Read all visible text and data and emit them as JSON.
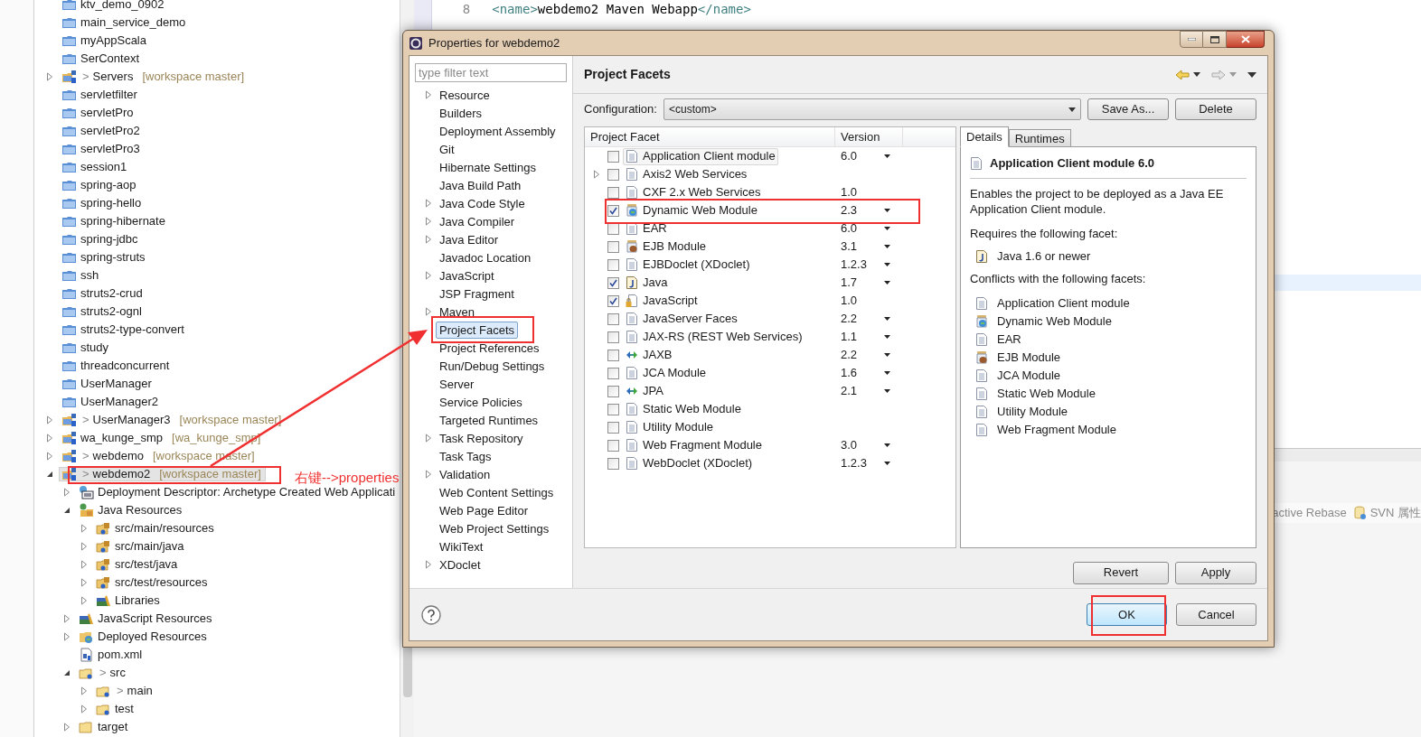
{
  "project_tree": [
    {
      "label": "ktv_demo_0902",
      "kind": "project",
      "selected": false
    },
    {
      "label": "main_service_demo",
      "kind": "project",
      "selected": false
    },
    {
      "label": "myAppScala",
      "kind": "project",
      "selected": false
    },
    {
      "label": "SerContext",
      "kind": "project",
      "selected": false
    },
    {
      "label": "Servers",
      "prefix": ">",
      "repo": "[workspace master]",
      "kind": "git-project",
      "expanded": false,
      "selected": false
    },
    {
      "label": "servletfilter",
      "kind": "project",
      "selected": false
    },
    {
      "label": "servletPro",
      "kind": "project",
      "selected": false
    },
    {
      "label": "servletPro2",
      "kind": "project",
      "selected": false
    },
    {
      "label": "servletPro3",
      "kind": "project",
      "selected": false
    },
    {
      "label": "session1",
      "kind": "project",
      "selected": false
    },
    {
      "label": "spring-aop",
      "kind": "project",
      "selected": false
    },
    {
      "label": "spring-hello",
      "kind": "project",
      "selected": false
    },
    {
      "label": "spring-hibernate",
      "kind": "project",
      "selected": false
    },
    {
      "label": "spring-jdbc",
      "kind": "project",
      "selected": false
    },
    {
      "label": "spring-struts",
      "kind": "project",
      "selected": false
    },
    {
      "label": "ssh",
      "kind": "project",
      "selected": false
    },
    {
      "label": "struts2-crud",
      "kind": "project",
      "selected": false
    },
    {
      "label": "struts2-ognl",
      "kind": "project",
      "selected": false
    },
    {
      "label": "struts2-type-convert",
      "kind": "project",
      "selected": false
    },
    {
      "label": "study",
      "kind": "project",
      "selected": false
    },
    {
      "label": "threadconcurrent",
      "kind": "project",
      "selected": false
    },
    {
      "label": "UserManager",
      "kind": "project",
      "selected": false
    },
    {
      "label": "UserManager2",
      "kind": "project",
      "selected": false
    },
    {
      "label": "UserManager3",
      "prefix": ">",
      "repo": "[workspace master]",
      "kind": "web-project",
      "expanded": false,
      "selected": false
    },
    {
      "label": "wa_kunge_smp",
      "repo": "[wa_kunge_smp]",
      "kind": "web-project",
      "expanded": false,
      "selected": false
    },
    {
      "label": "webdemo",
      "prefix": ">",
      "repo": "[workspace master]",
      "kind": "maven-project",
      "expanded": false,
      "selected": false
    },
    {
      "label": "webdemo2",
      "prefix": ">",
      "repo": "[workspace master]",
      "kind": "maven-project",
      "expanded": true,
      "selected": true,
      "children": [
        {
          "label": "Deployment Descriptor: Archetype Created Web Applicati",
          "kind": "descriptor",
          "expanded": false,
          "selected": false
        },
        {
          "label": "Java Resources",
          "kind": "java-resources",
          "expanded": true,
          "selected": false,
          "children": [
            {
              "label": "src/main/resources",
              "kind": "src-folder",
              "expanded": false,
              "selected": false
            },
            {
              "label": "src/main/java",
              "kind": "src-folder",
              "expanded": false,
              "selected": false
            },
            {
              "label": "src/test/java",
              "kind": "src-folder",
              "expanded": false,
              "selected": false
            },
            {
              "label": "src/test/resources",
              "kind": "src-folder",
              "expanded": false,
              "selected": false
            },
            {
              "label": "Libraries",
              "kind": "library",
              "expanded": false,
              "selected": false
            }
          ]
        },
        {
          "label": "JavaScript Resources",
          "kind": "library",
          "expanded": false,
          "selected": false
        },
        {
          "label": "Deployed Resources",
          "kind": "deployed",
          "expanded": false,
          "selected": false
        },
        {
          "label": "pom.xml",
          "kind": "xml-file",
          "selected": false
        },
        {
          "label": "src",
          "prefix": ">",
          "kind": "git-folder",
          "expanded": true,
          "selected": false,
          "children": [
            {
              "label": "main",
              "prefix": ">",
              "kind": "git-folder",
              "expanded": false,
              "selected": false
            },
            {
              "label": "test",
              "kind": "git-folder",
              "expanded": false,
              "selected": false
            }
          ]
        },
        {
          "label": "target",
          "kind": "folder",
          "expanded": false,
          "selected": false
        }
      ]
    }
  ],
  "editor": {
    "lines": [
      {
        "number": "8",
        "segments": [
          {
            "kind": "tag",
            "text": "<name>"
          },
          {
            "kind": "text",
            "text": "webdemo2 Maven Webapp"
          },
          {
            "kind": "tag",
            "text": "</name>"
          }
        ]
      }
    ]
  },
  "bottom_toolbar": {
    "items": [
      "active Rebase",
      "SVN 属性"
    ]
  },
  "annotation": {
    "text": "右键-->properties"
  },
  "dialog": {
    "title": "Properties for webdemo2",
    "filter": {
      "placeholder": "type filter text"
    },
    "nav_items": [
      {
        "label": "Resource",
        "expanded": false,
        "selected": false
      },
      {
        "label": "Builders",
        "selected": false
      },
      {
        "label": "Deployment Assembly",
        "selected": false
      },
      {
        "label": "Git",
        "selected": false
      },
      {
        "label": "Hibernate Settings",
        "selected": false
      },
      {
        "label": "Java Build Path",
        "selected": false
      },
      {
        "label": "Java Code Style",
        "expanded": false,
        "selected": false
      },
      {
        "label": "Java Compiler",
        "expanded": false,
        "selected": false
      },
      {
        "label": "Java Editor",
        "expanded": false,
        "selected": false
      },
      {
        "label": "Javadoc Location",
        "selected": false
      },
      {
        "label": "JavaScript",
        "expanded": false,
        "selected": false
      },
      {
        "label": "JSP Fragment",
        "selected": false
      },
      {
        "label": "Maven",
        "expanded": false,
        "selected": false
      },
      {
        "label": "Project Facets",
        "selected": true
      },
      {
        "label": "Project References",
        "selected": false
      },
      {
        "label": "Run/Debug Settings",
        "selected": false
      },
      {
        "label": "Server",
        "selected": false
      },
      {
        "label": "Service Policies",
        "selected": false
      },
      {
        "label": "Targeted Runtimes",
        "selected": false
      },
      {
        "label": "Task Repository",
        "expanded": false,
        "selected": false
      },
      {
        "label": "Task Tags",
        "selected": false
      },
      {
        "label": "Validation",
        "expanded": false,
        "selected": false
      },
      {
        "label": "Web Content Settings",
        "selected": false
      },
      {
        "label": "Web Page Editor",
        "selected": false
      },
      {
        "label": "Web Project Settings",
        "selected": false
      },
      {
        "label": "WikiText",
        "selected": false
      },
      {
        "label": "XDoclet",
        "expanded": false,
        "selected": false
      }
    ],
    "page_title": "Project Facets",
    "configuration": {
      "label": "Configuration:",
      "value": "<custom>"
    },
    "config_buttons": [
      "Save As...",
      "Delete"
    ],
    "facets": {
      "columns": [
        "Project Facet",
        "Version"
      ],
      "rows": [
        {
          "name": "Application Client module",
          "version": "6.0",
          "has_versions": true,
          "checked": false,
          "kind": "doc",
          "selected": true
        },
        {
          "name": "Axis2 Web Services",
          "checked": false,
          "kind": "doc",
          "expanded": false,
          "selected": false
        },
        {
          "name": "CXF 2.x Web Services",
          "version": "1.0",
          "has_versions": false,
          "checked": false,
          "kind": "doc",
          "selected": false
        },
        {
          "name": "Dynamic Web Module",
          "version": "2.3",
          "has_versions": true,
          "checked": true,
          "kind": "web-jar",
          "selected": false
        },
        {
          "name": "EAR",
          "version": "6.0",
          "has_versions": true,
          "checked": false,
          "kind": "doc",
          "selected": false
        },
        {
          "name": "EJB Module",
          "version": "3.1",
          "has_versions": true,
          "checked": false,
          "kind": "bean-jar",
          "selected": false
        },
        {
          "name": "EJBDoclet (XDoclet)",
          "version": "1.2.3",
          "has_versions": true,
          "checked": false,
          "kind": "doc",
          "selected": false
        },
        {
          "name": "Java",
          "version": "1.7",
          "has_versions": true,
          "checked": true,
          "kind": "java",
          "selected": false
        },
        {
          "name": "JavaScript",
          "version": "1.0",
          "has_versions": false,
          "checked": true,
          "kind": "locked-doc",
          "selected": false
        },
        {
          "name": "JavaServer Faces",
          "version": "2.2",
          "has_versions": true,
          "checked": false,
          "kind": "doc",
          "selected": false
        },
        {
          "name": "JAX-RS (REST Web Services)",
          "version": "1.1",
          "has_versions": true,
          "checked": false,
          "kind": "doc",
          "selected": false
        },
        {
          "name": "JAXB",
          "version": "2.2",
          "has_versions": true,
          "checked": false,
          "kind": "arrows",
          "selected": false
        },
        {
          "name": "JCA Module",
          "version": "1.6",
          "has_versions": true,
          "checked": false,
          "kind": "doc",
          "selected": false
        },
        {
          "name": "JPA",
          "version": "2.1",
          "has_versions": true,
          "checked": false,
          "kind": "arrows",
          "selected": false
        },
        {
          "name": "Static Web Module",
          "checked": false,
          "kind": "doc",
          "selected": false
        },
        {
          "name": "Utility Module",
          "checked": false,
          "kind": "doc",
          "selected": false
        },
        {
          "name": "Web Fragment Module",
          "version": "3.0",
          "has_versions": true,
          "checked": false,
          "kind": "doc",
          "selected": false
        },
        {
          "name": "WebDoclet (XDoclet)",
          "version": "1.2.3",
          "has_versions": true,
          "checked": false,
          "kind": "doc",
          "selected": false
        }
      ]
    },
    "details_tabs": [
      {
        "label": "Details",
        "selected": true
      },
      {
        "label": "Runtimes",
        "selected": false
      }
    ],
    "details": {
      "title": "Application Client module 6.0",
      "kind": "doc",
      "description": "Enables the project to be deployed as a Java EE Application Client module.",
      "requires_label": "Requires the following facet:",
      "requires": [
        {
          "label": "Java 1.6 or newer",
          "kind": "java"
        }
      ],
      "conflicts_label": "Conflicts with the following facets:",
      "conflicts": [
        {
          "label": "Application Client module",
          "kind": "doc"
        },
        {
          "label": "Dynamic Web Module",
          "kind": "web-jar"
        },
        {
          "label": "EAR",
          "kind": "doc"
        },
        {
          "label": "EJB Module",
          "kind": "bean-jar"
        },
        {
          "label": "JCA Module",
          "kind": "doc"
        },
        {
          "label": "Static Web Module",
          "kind": "doc"
        },
        {
          "label": "Utility Module",
          "kind": "doc"
        },
        {
          "label": "Web Fragment Module",
          "kind": "doc"
        }
      ]
    },
    "page_buttons": [
      "Revert",
      "Apply"
    ],
    "buttons": [
      "OK",
      "Cancel"
    ]
  }
}
